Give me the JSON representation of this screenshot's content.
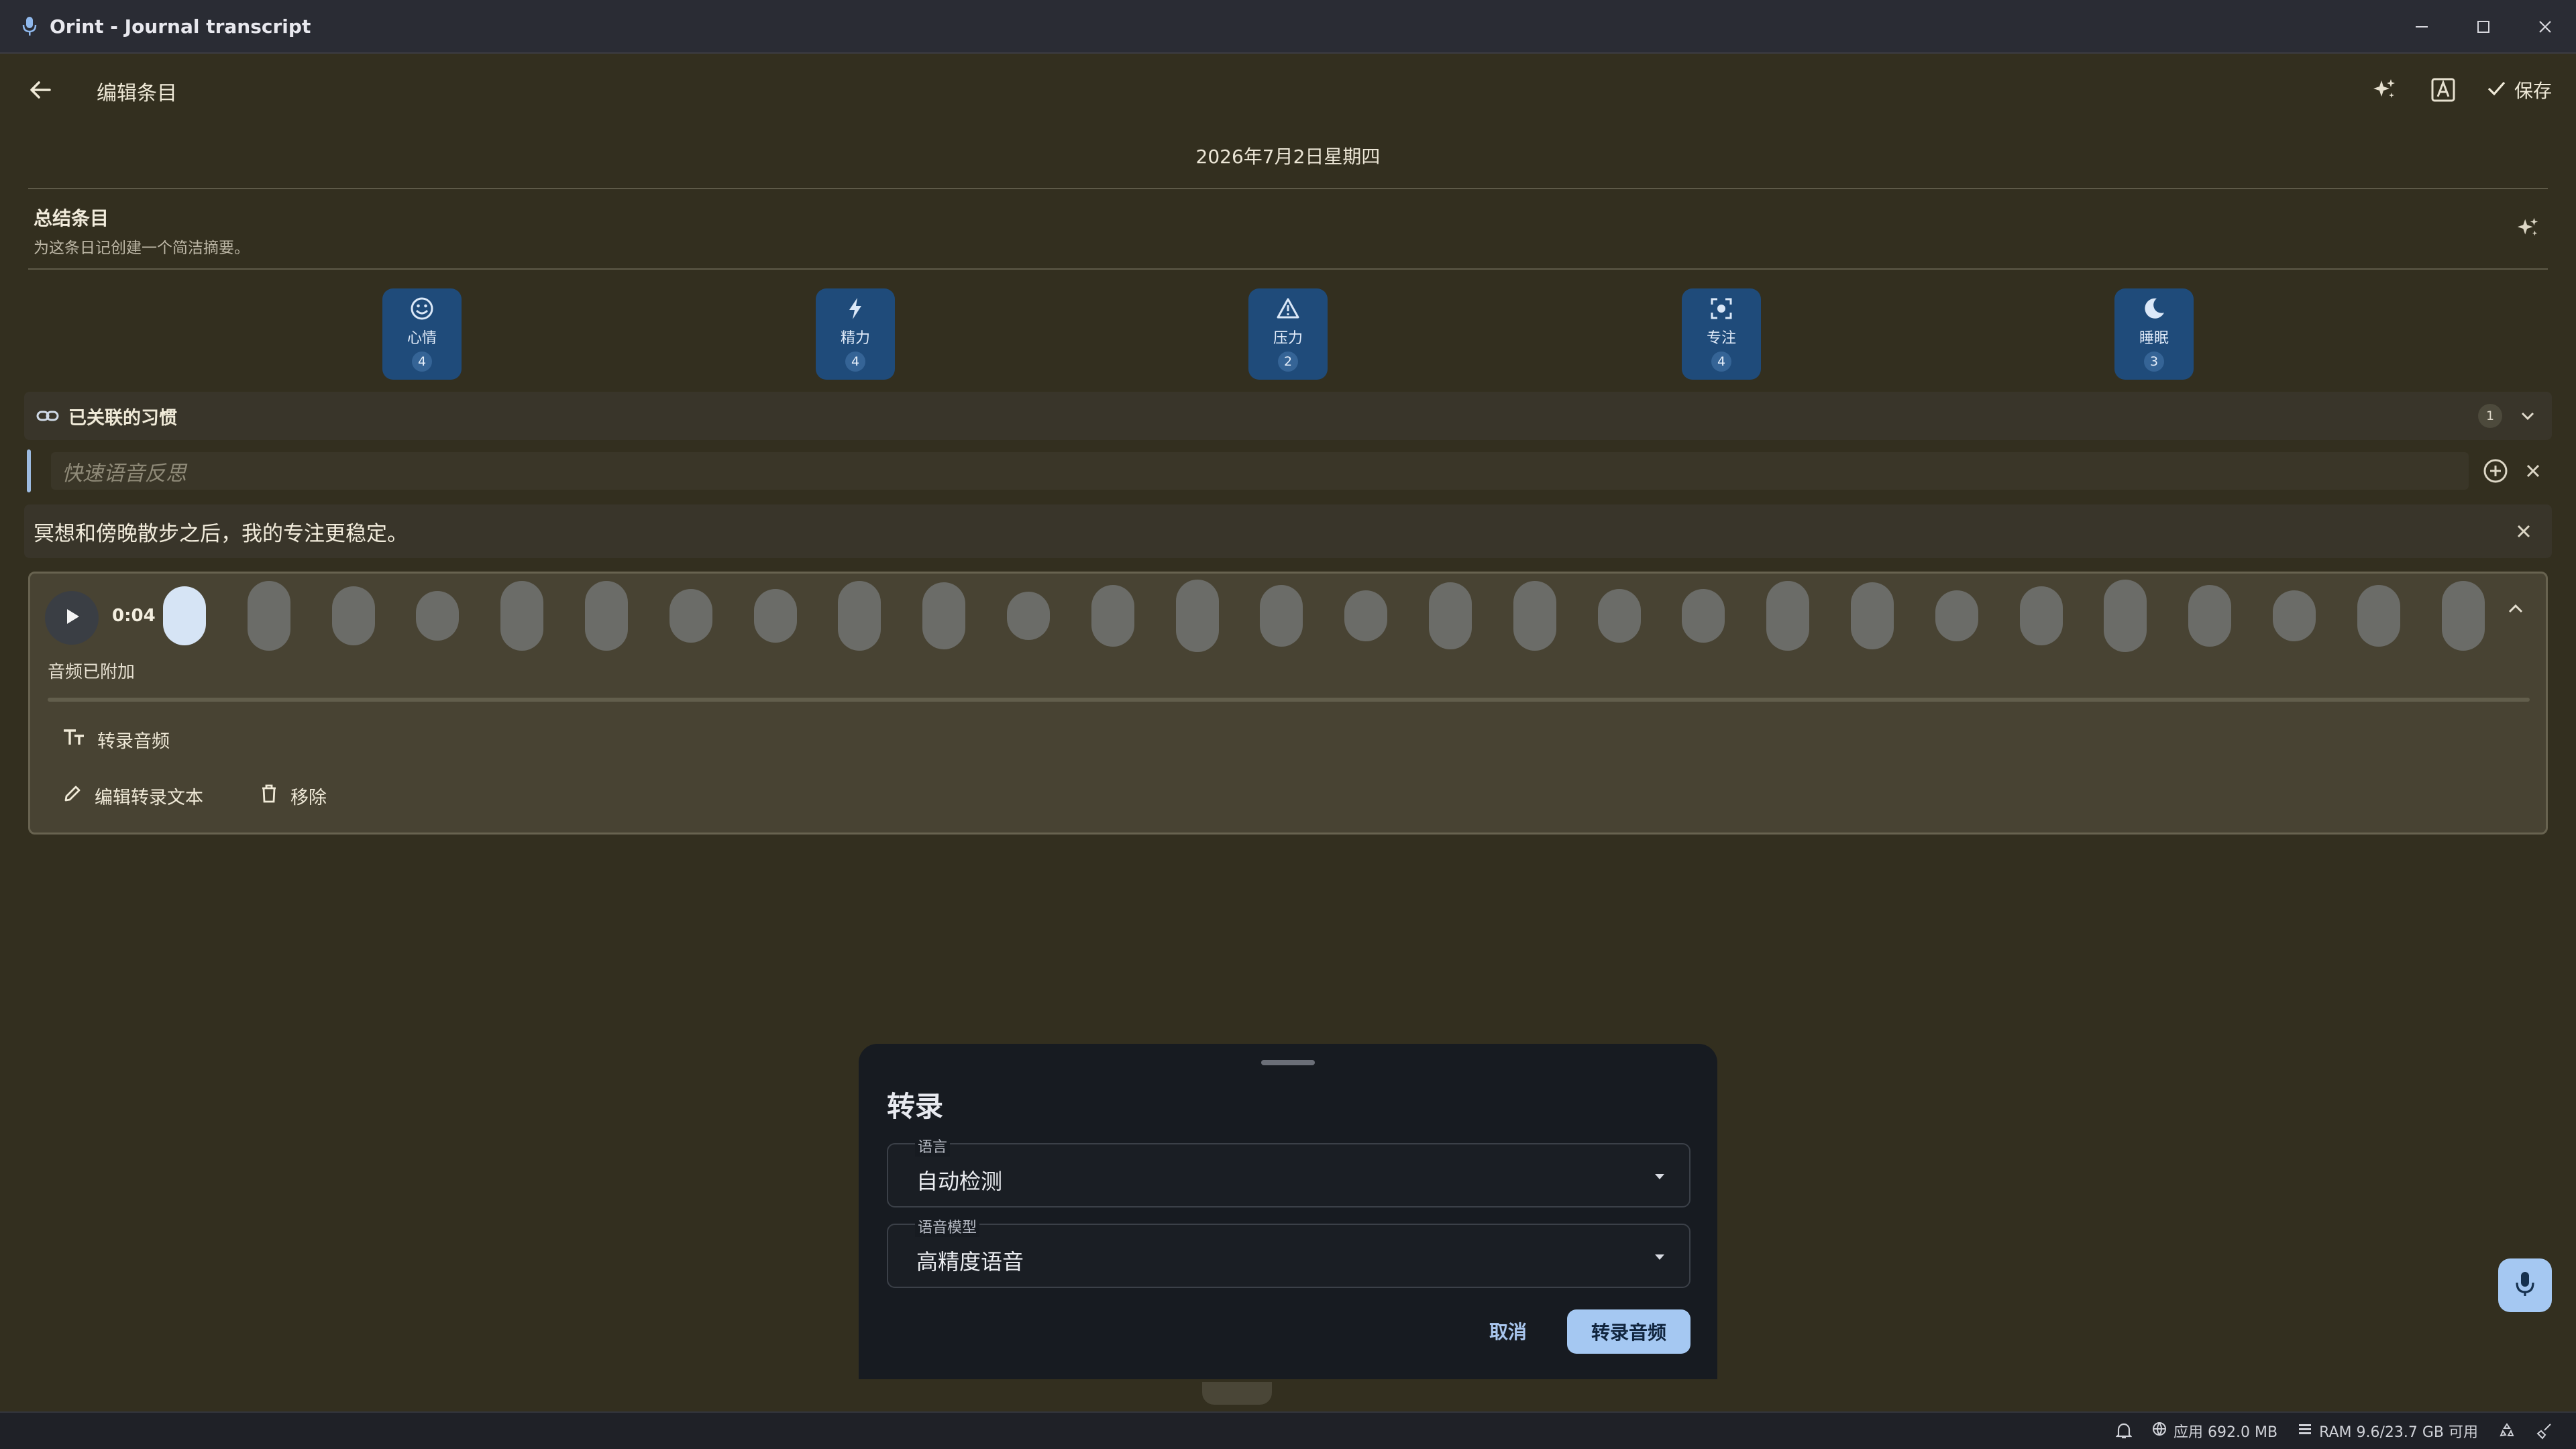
{
  "window": {
    "title": "Orint - Journal transcript",
    "controls": [
      "minimize-icon",
      "maximize-icon",
      "close-icon"
    ]
  },
  "appbar": {
    "title": "编辑条目",
    "save_label": "保存",
    "actions": [
      "sparkle-icon",
      "font-icon",
      "check-icon"
    ]
  },
  "entry": {
    "date": "2026年7月2日星期四",
    "summary": {
      "title": "总结条目",
      "subtitle": "为这条日记创建一个简洁摘要。"
    },
    "metrics": [
      {
        "label": "心情",
        "value": "4",
        "icon": "smile-icon"
      },
      {
        "label": "精力",
        "value": "4",
        "icon": "bolt-icon"
      },
      {
        "label": "压力",
        "value": "2",
        "icon": "warning-icon"
      },
      {
        "label": "专注",
        "value": "4",
        "icon": "focus-icon"
      },
      {
        "label": "睡眠",
        "value": "3",
        "icon": "moon-icon"
      }
    ],
    "habits": {
      "label": "已关联的习惯",
      "count": "1"
    },
    "quick_reflection": {
      "placeholder": "快速语音反思"
    },
    "note": {
      "text": "冥想和傍晚散步之后，我的专注更稳定。"
    },
    "audio": {
      "time": "0:04",
      "status": "音频已附加",
      "progress": 0.0,
      "actions": {
        "transcribe": "转录音频",
        "edit_transcript": "编辑转录文本",
        "remove": "移除"
      }
    }
  },
  "transcribe_sheet": {
    "title": "转录",
    "language": {
      "label": "语言",
      "value": "自动检测"
    },
    "model": {
      "label": "语音模型",
      "value": "高精度语音"
    },
    "cancel": "取消",
    "confirm": "转录音频"
  },
  "statusbar": {
    "app_memory": "应用 692.0 MB",
    "ram": "RAM 9.6/23.7 GB 可用"
  },
  "colors": {
    "background": "#332f1f",
    "accent": "#a5c8f2",
    "metric_tile": "#1f4b7a",
    "sheet": "#171b21"
  }
}
